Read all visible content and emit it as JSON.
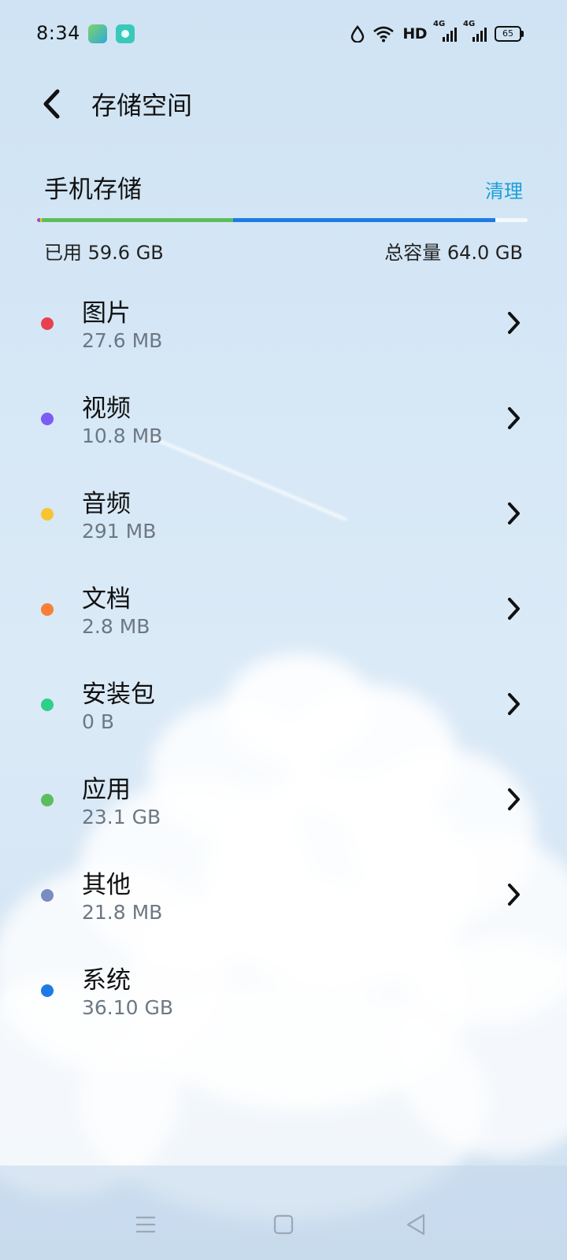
{
  "status_bar": {
    "time": "8:34",
    "network": "HD",
    "signal_labels": [
      "4G",
      "4G"
    ],
    "battery": "65"
  },
  "header": {
    "title": "存储空间"
  },
  "storage": {
    "title": "手机存储",
    "clean_label": "清理",
    "used_label": "已用 59.6 GB",
    "total_label": "总容量 64.0 GB",
    "usage_segments": [
      {
        "category": "图片",
        "fraction": 0.004,
        "color": "#e8404f"
      },
      {
        "category": "视频",
        "fraction": 0.002,
        "color": "#7b5cf5"
      },
      {
        "category": "音频",
        "fraction": 0.004,
        "color": "#f7c531"
      },
      {
        "category": "应用",
        "fraction": 0.39,
        "color": "#5cbd5c"
      },
      {
        "category": "系统",
        "fraction": 0.535,
        "color": "#1e7be6"
      }
    ]
  },
  "categories": [
    {
      "name": "图片",
      "size": "27.6 MB",
      "color": "#e8404f",
      "has_chevron": true
    },
    {
      "name": "视频",
      "size": "10.8 MB",
      "color": "#7b5cf5",
      "has_chevron": true
    },
    {
      "name": "音频",
      "size": "291 MB",
      "color": "#f7c531",
      "has_chevron": true
    },
    {
      "name": "文档",
      "size": "2.8 MB",
      "color": "#f78036",
      "has_chevron": true
    },
    {
      "name": "安装包",
      "size": "0 B",
      "color": "#2ecf8a",
      "has_chevron": true
    },
    {
      "name": "应用",
      "size": "23.1 GB",
      "color": "#5cbd5c",
      "has_chevron": true
    },
    {
      "name": "其他",
      "size": "21.8 MB",
      "color": "#7a8bc2",
      "has_chevron": true
    },
    {
      "name": "系统",
      "size": "36.10 GB",
      "color": "#1e7be6",
      "has_chevron": false
    }
  ],
  "nav": {
    "icons": [
      "menu-icon",
      "home-icon",
      "back-triangle-icon"
    ]
  }
}
